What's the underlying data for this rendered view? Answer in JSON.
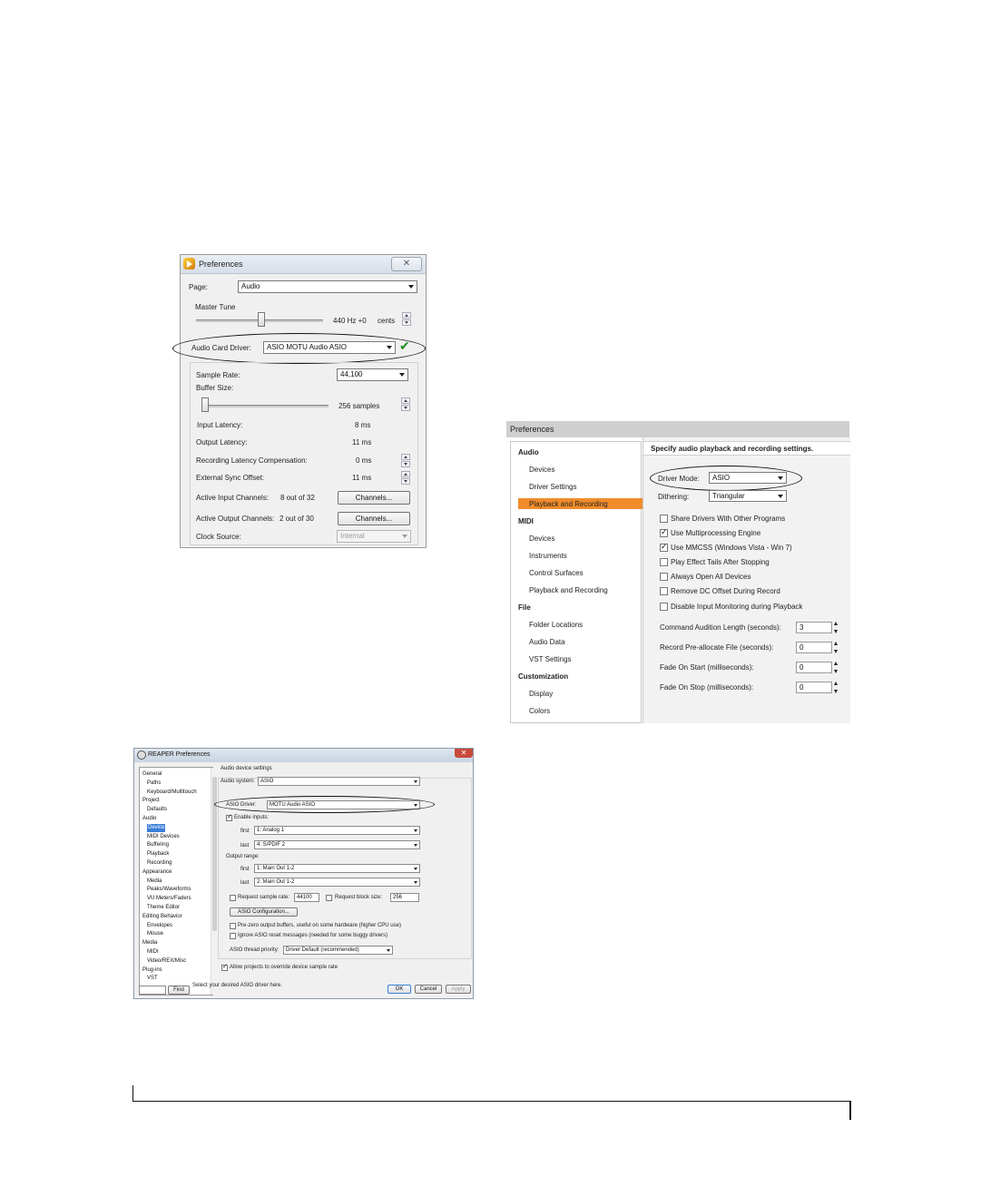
{
  "win1": {
    "title": "Preferences",
    "close": "✕",
    "page_label": "Page:",
    "page_value": "Audio",
    "master_tune_label": "Master Tune",
    "tune_value": "440 Hz +0",
    "tune_unit": "cents",
    "driver_label": "Audio Card Driver:",
    "driver_value": "ASIO MOTU Audio ASIO",
    "driver_ok": "✔",
    "sample_rate_label": "Sample Rate:",
    "sample_rate_value": "44,100",
    "buffer_label": "Buffer Size:",
    "buffer_value": "256 samples",
    "input_latency_label": "Input Latency:",
    "input_latency_value": "8 ms",
    "output_latency_label": "Output Latency:",
    "output_latency_value": "11 ms",
    "rec_comp_label": "Recording Latency Compensation:",
    "rec_comp_value": "0 ms",
    "ext_sync_label": "External Sync Offset:",
    "ext_sync_value": "11 ms",
    "active_in_label": "Active Input Channels:",
    "active_in_value": "8 out of 32",
    "active_out_label": "Active Output Channels:",
    "active_out_value": "2 out of 30",
    "channels_btn": "Channels...",
    "clock_label": "Clock Source:",
    "clock_value": "Internal"
  },
  "win2": {
    "title": "Preferences",
    "sidebar": [
      {
        "label": "Audio",
        "head": true
      },
      {
        "label": "Devices"
      },
      {
        "label": "Driver Settings"
      },
      {
        "label": "Playback and Recording",
        "selected": true
      },
      {
        "label": "MIDI",
        "head": true
      },
      {
        "label": "Devices"
      },
      {
        "label": "Instruments"
      },
      {
        "label": "Control Surfaces"
      },
      {
        "label": "Playback and Recording"
      },
      {
        "label": "File",
        "head": true
      },
      {
        "label": "Folder Locations"
      },
      {
        "label": "Audio Data"
      },
      {
        "label": "VST Settings"
      },
      {
        "label": "Customization",
        "head": true
      },
      {
        "label": "Display"
      },
      {
        "label": "Colors"
      }
    ],
    "heading": "Specify audio playback and recording settings.",
    "driver_mode_label": "Driver Mode:",
    "driver_mode_value": "ASIO",
    "dithering_label": "Dithering:",
    "dithering_value": "Triangular",
    "options": [
      {
        "label": "Share Drivers With Other Programs",
        "checked": false
      },
      {
        "label": "Use Multiprocessing Engine",
        "checked": true
      },
      {
        "label": "Use MMCSS (Windows Vista - Win 7)",
        "checked": true
      },
      {
        "label": "Play Effect Tails After Stopping",
        "checked": false
      },
      {
        "label": "Always Open All Devices",
        "checked": false
      },
      {
        "label": "Remove DC Offset During Record",
        "checked": false
      },
      {
        "label": "Disable Input Monitoring during Playback",
        "checked": false
      }
    ],
    "fields": [
      {
        "label": "Command Audition Length (seconds):",
        "value": "3"
      },
      {
        "label": "Record Pre-allocate File (seconds):",
        "value": "0"
      },
      {
        "label": "Fade On Start  (milliseconds):",
        "value": "0"
      },
      {
        "label": "Fade On Stop  (milliseconds):",
        "value": "0"
      }
    ]
  },
  "win3": {
    "title": "REAPER Preferences",
    "close": "✕",
    "tree": [
      {
        "label": "General",
        "lvl": 0
      },
      {
        "label": "Paths",
        "lvl": 1
      },
      {
        "label": "Keyboard/Multitouch",
        "lvl": 1
      },
      {
        "label": "Project",
        "lvl": 0
      },
      {
        "label": "Defaults",
        "lvl": 1
      },
      {
        "label": "Audio",
        "lvl": 0
      },
      {
        "label": "Device",
        "lvl": 1,
        "selected": true
      },
      {
        "label": "MIDI Devices",
        "lvl": 1
      },
      {
        "label": "Buffering",
        "lvl": 1
      },
      {
        "label": "Playback",
        "lvl": 1
      },
      {
        "label": "Recording",
        "lvl": 1
      },
      {
        "label": "Appearance",
        "lvl": 0
      },
      {
        "label": "Media",
        "lvl": 1
      },
      {
        "label": "Peaks/Waveforms",
        "lvl": 1
      },
      {
        "label": "VU Meters/Faders",
        "lvl": 1
      },
      {
        "label": "Theme Editor",
        "lvl": 1
      },
      {
        "label": "Editing Behavior",
        "lvl": 0
      },
      {
        "label": "Envelopes",
        "lvl": 1
      },
      {
        "label": "Mouse",
        "lvl": 1
      },
      {
        "label": "Media",
        "lvl": 0
      },
      {
        "label": "MIDI",
        "lvl": 1
      },
      {
        "label": "Video/REX/Misc",
        "lvl": 1
      },
      {
        "label": "Plug-ins",
        "lvl": 0
      },
      {
        "label": "VST",
        "lvl": 1
      }
    ],
    "section_label": "Audio device settings",
    "audio_system_label": "Audio system:",
    "audio_system_value": "ASIO",
    "asio_driver_label": "ASIO Driver:",
    "asio_driver_value": "MOTU Audio ASIO",
    "enable_inputs": "Enable inputs:",
    "first_label": "first",
    "last_label": "last",
    "input_first": "1: Analog 1",
    "input_last": "4: S/PDIF 2",
    "output_range": "Output range:",
    "output_first": "1: Main Out 1-2",
    "output_last": "2: Main Out 1-2",
    "req_rate_label": "Request sample rate:",
    "req_rate_value": "44100",
    "req_block_label": "Request block size:",
    "req_block_value": "256",
    "asio_config": "ASIO Configuration...",
    "prezero": "Pre-zero output buffers, useful on some hardware (higher CPU use)",
    "ignore_reset": "Ignore ASIO reset messages (needed for some buggy drivers)",
    "thread_label": "ASIO thread priority:",
    "thread_value": "Driver Default (recommended)",
    "allow_projects": "Allow projects to override device sample rate",
    "find_btn": "Find",
    "hint": "Select your desired ASIO driver here.",
    "ok": "OK",
    "cancel": "Cancel",
    "apply": "Apply"
  }
}
